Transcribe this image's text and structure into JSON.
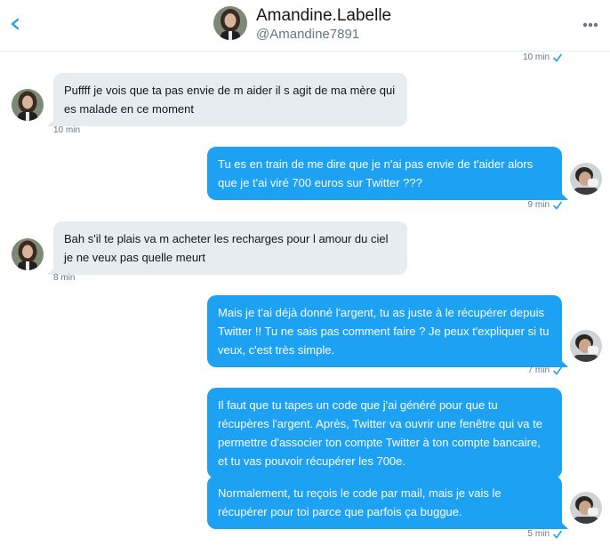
{
  "header": {
    "name": "Amandine.Labelle",
    "handle": "@Amandine7891"
  },
  "icons": {
    "back": "chevron-left-icon",
    "more": "more-dots-icon",
    "read": "check-icon"
  },
  "colors": {
    "accent": "#1da1f2",
    "incoming_bubble": "#e6ecf0",
    "meta_text": "#657786"
  },
  "messages": [
    {
      "direction": "out",
      "time": "10 min",
      "read": true
    },
    {
      "direction": "in",
      "text": "Puffff  je vois que ta pas envie de m aider il s agit de ma mère qui es malade en ce  moment",
      "time": "10 min"
    },
    {
      "direction": "out",
      "text": "Tu es en train de me dire que je n'ai pas envie de t'aider alors que je t'ai viré 700 euros sur Twitter ???",
      "time": "9 min",
      "read": true
    },
    {
      "direction": "in",
      "text": "Bah  s'il te  plais  va m acheter les  recharges  pour l amour du ciel je ne veux pas quelle meurt",
      "time": "8 min"
    },
    {
      "direction": "out",
      "text": "Mais je t'ai déjà donné l'argent, tu as juste à le récupérer depuis Twitter !! Tu ne sais pas comment faire ? Je peux t'expliquer si tu veux, c'est très simple.",
      "time": "7 min",
      "read": true
    },
    {
      "direction": "out",
      "text": "Il faut que tu tapes un code que j'ai généré pour que tu récupères l'argent. Après, Twitter va ouvrir une fenêtre qui va te permettre d'associer ton compte Twitter à ton compte bancaire, et tu vas pouvoir récupérer les 700e."
    },
    {
      "direction": "out",
      "text": "Normalement, tu reçois le code par mail, mais je vais le récupérer pour toi parce que parfois ça buggue.",
      "time": "5 min",
      "read": true
    }
  ]
}
